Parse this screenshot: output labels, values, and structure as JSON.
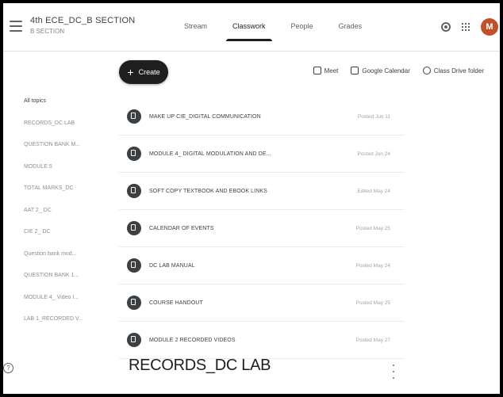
{
  "header": {
    "class_title": "4th ECE_DC_B SECTION",
    "class_subtitle": "B SECTION",
    "tabs": [
      {
        "label": "Stream"
      },
      {
        "label": "Classwork"
      },
      {
        "label": "People"
      },
      {
        "label": "Grades"
      }
    ],
    "active_tab": "Classwork",
    "avatar_letter": "M",
    "avatar_color": "#c0502a"
  },
  "toolbar": {
    "create_label": "Create",
    "meet_label": "Meet",
    "calendar_label": "Google Calendar",
    "drive_label": "Class Drive folder"
  },
  "topics": [
    "All topics",
    "RECORDS_DC LAB",
    "QUESTION BANK M...",
    "MODULE 5",
    "TOTAL MARKS_DC",
    "AAT 2_ DC",
    "CIE 2_ DC",
    "Question bank mod...",
    "QUESTION BANK 1...",
    "MODULE 4_ Video I...",
    "LAB 1_RECORDED V..."
  ],
  "items": [
    {
      "title": "MAKE UP CIE_DIGITAL COMMUNICATION",
      "date": "Posted Jun 11"
    },
    {
      "title": "MODULE 4_ DIGITAL MODULATION AND DE...",
      "date": "Posted Jun 24"
    },
    {
      "title": "SOFT COPY TEXTBOOK AND EBOOK LINKS",
      "date": "Edited May 24"
    },
    {
      "title": "CALENDAR OF EVENTS",
      "date": "Posted May 25"
    },
    {
      "title": "DC LAB MANUAL",
      "date": "Posted May 24"
    },
    {
      "title": "COURSE HANDOUT",
      "date": "Posted May 25"
    },
    {
      "title": "MODULE 2 RECORDED VIDEOS",
      "date": "Posted May 27"
    }
  ],
  "section": {
    "title": "RECORDS_DC LAB"
  }
}
